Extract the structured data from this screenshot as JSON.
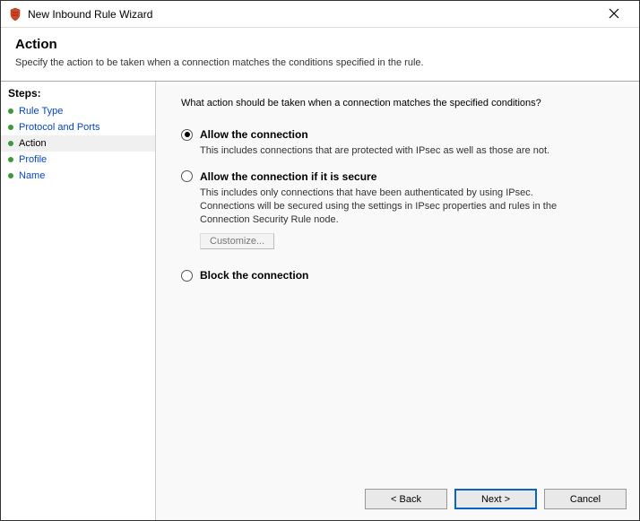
{
  "window": {
    "title": "New Inbound Rule Wizard"
  },
  "header": {
    "title": "Action",
    "desc": "Specify the action to be taken when a connection matches the conditions specified in the rule."
  },
  "sidebar": {
    "title": "Steps:",
    "items": [
      {
        "label": "Rule Type",
        "state": "done"
      },
      {
        "label": "Protocol and Ports",
        "state": "done"
      },
      {
        "label": "Action",
        "state": "current"
      },
      {
        "label": "Profile",
        "state": "pending"
      },
      {
        "label": "Name",
        "state": "pending"
      }
    ]
  },
  "content": {
    "prompt": "What action should be taken when a connection matches the specified conditions?",
    "options": [
      {
        "id": "allow",
        "title": "Allow the connection",
        "desc": "This includes connections that are protected with IPsec as well as those are not.",
        "checked": true
      },
      {
        "id": "allow-secure",
        "title": "Allow the connection if it is secure",
        "desc": "This includes only connections that have been authenticated by using IPsec.  Connections will be secured using the settings in IPsec properties and rules in the Connection Security Rule node.",
        "checked": false,
        "customize_label": "Customize...",
        "customize_enabled": false
      },
      {
        "id": "block",
        "title": "Block the connection",
        "desc": "",
        "checked": false
      }
    ]
  },
  "footer": {
    "back": "< Back",
    "next": "Next >",
    "cancel": "Cancel"
  }
}
